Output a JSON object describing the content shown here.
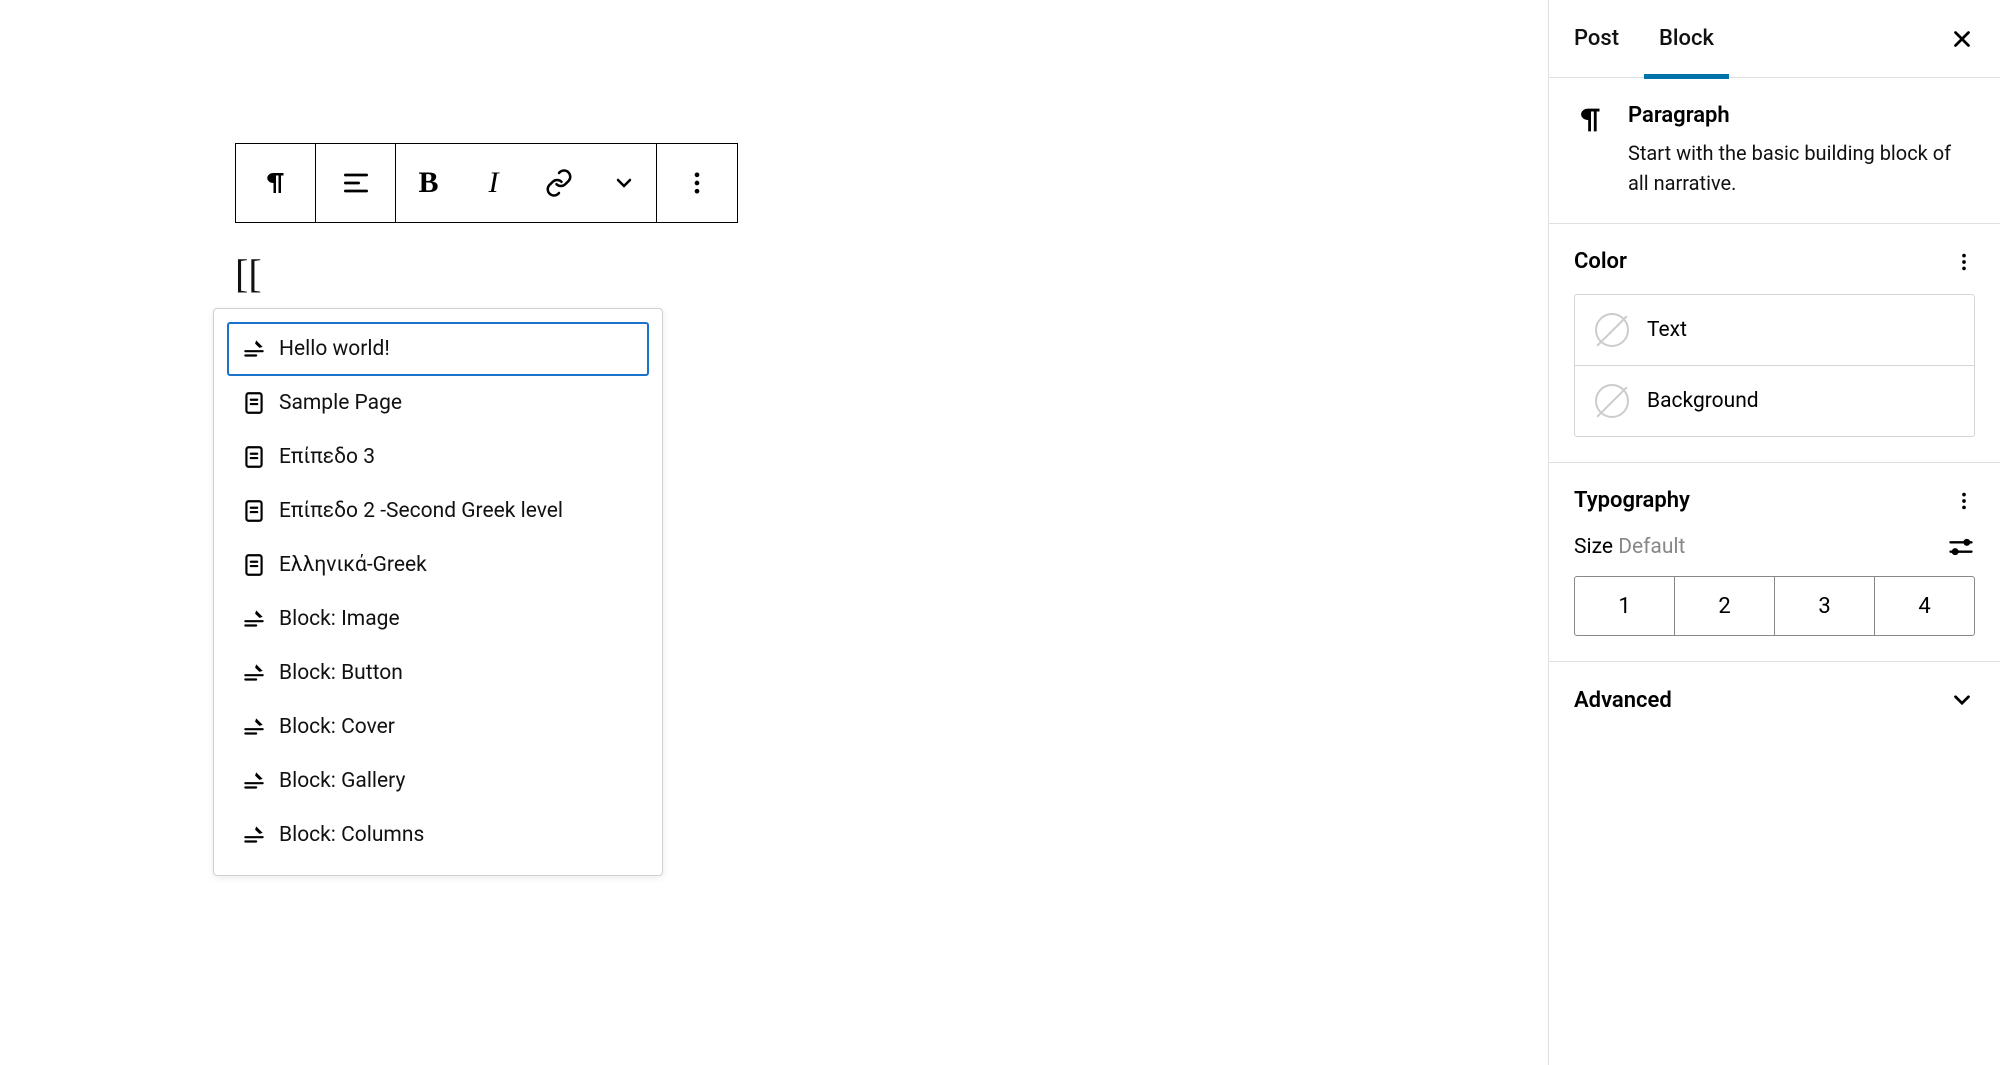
{
  "content_text": "[[",
  "autocomplete": [
    {
      "icon": "post",
      "label": "Hello world!"
    },
    {
      "icon": "page",
      "label": "Sample Page"
    },
    {
      "icon": "page",
      "label": "Επίπεδο 3"
    },
    {
      "icon": "page",
      "label": "Επίπεδο 2 -Second Greek level"
    },
    {
      "icon": "page",
      "label": "Ελληνικά-Greek"
    },
    {
      "icon": "post",
      "label": "Block: Image"
    },
    {
      "icon": "post",
      "label": "Block: Button"
    },
    {
      "icon": "post",
      "label": "Block: Cover"
    },
    {
      "icon": "post",
      "label": "Block: Gallery"
    },
    {
      "icon": "post",
      "label": "Block: Columns"
    }
  ],
  "sidebar": {
    "tabs": {
      "post": "Post",
      "block": "Block"
    },
    "block_name": "Paragraph",
    "block_desc": "Start with the basic building block of all narrative.",
    "color_heading": "Color",
    "color_text": "Text",
    "color_bg": "Background",
    "typo_heading": "Typography",
    "size_label": "Size",
    "size_default": "Default",
    "sizes": [
      "1",
      "2",
      "3",
      "4"
    ],
    "advanced": "Advanced"
  }
}
